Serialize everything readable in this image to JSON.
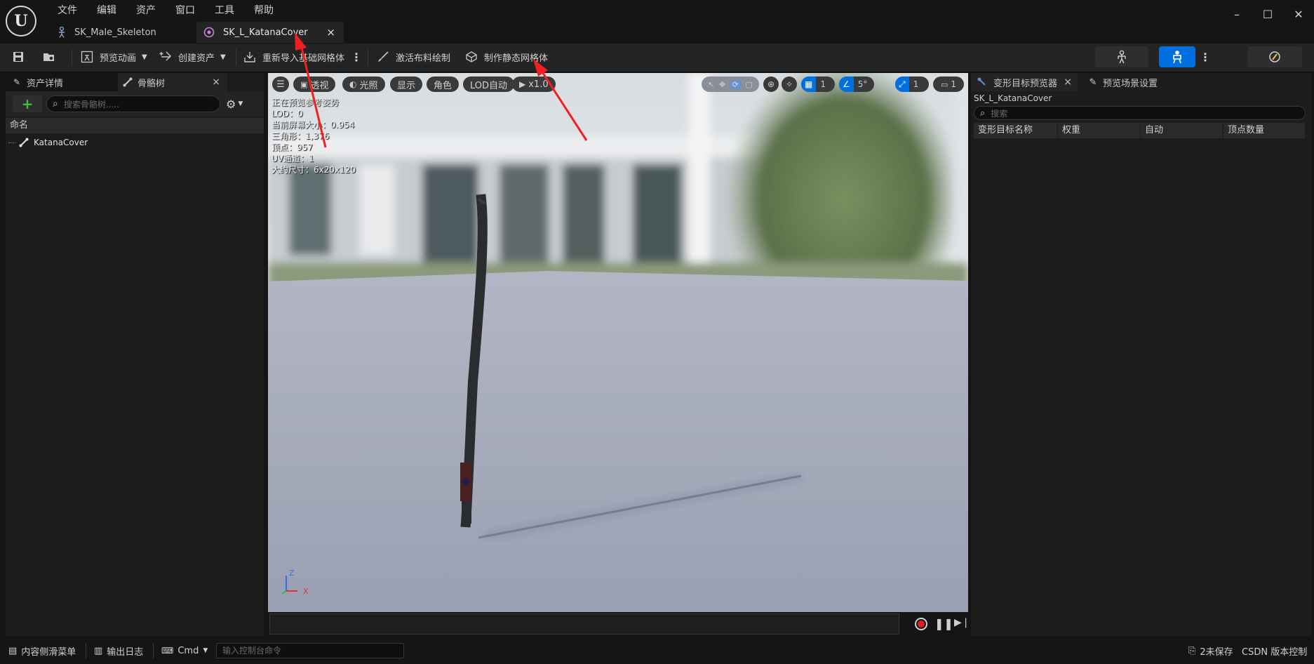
{
  "menu": {
    "items": [
      "文件",
      "编辑",
      "资产",
      "窗口",
      "工具",
      "帮助"
    ]
  },
  "tabs": [
    {
      "label": "SK_Male_Skeleton"
    },
    {
      "label": "SK_L_KatanaCover",
      "close": "×"
    }
  ],
  "toolbar": {
    "preview_anim": "预览动画",
    "create_asset": "创建资产",
    "reimport": "重新导入基础网格体",
    "cloth_paint": "激活布料绘制",
    "make_static_mesh": "制作静态网格体"
  },
  "left_panel": {
    "tab_details": "资产详情",
    "tab_skeleton": "骨骼树",
    "close": "×",
    "add": "+",
    "search_placeholder": "搜索骨骼树.....",
    "column_name": "命名",
    "tree": [
      {
        "label": "KatanaCover"
      }
    ]
  },
  "viewport": {
    "buttons": {
      "perspective": "透视",
      "lighting": "光照",
      "show": "显示",
      "character": "角色",
      "lod": "LOD自动",
      "speed": "x1.0"
    },
    "right_buttons": {
      "grid_count": "1",
      "angle": "5°",
      "scale": "1",
      "camera": "1"
    },
    "stats": [
      "正在预览参考姿势",
      "LOD：0",
      "当前屏幕大小：0.954",
      "三角形：1,376",
      "顶点：957",
      "UV通道：1",
      "大约尺寸：6x20x120"
    ],
    "axis": {
      "z": "Z",
      "x": "X"
    }
  },
  "right_panel": {
    "tab_morph": "变形目标预览器",
    "tab_scene": "预览场景设置",
    "close": "×",
    "asset_name": "SK_L_KatanaCover",
    "search_placeholder": "搜索",
    "columns": [
      "变形目标名称",
      "权重",
      "自动",
      "顶点数量"
    ]
  },
  "statusbar": {
    "content_drawer": "内容侧滑菜单",
    "output_log": "输出日志",
    "cmd": "Cmd",
    "console_placeholder": "输入控制台命令",
    "unsaved": "2未保存",
    "source_control": "CSDN 版本控制"
  },
  "colors": {
    "accent": "#0070e0",
    "annotation": "#f02020"
  }
}
